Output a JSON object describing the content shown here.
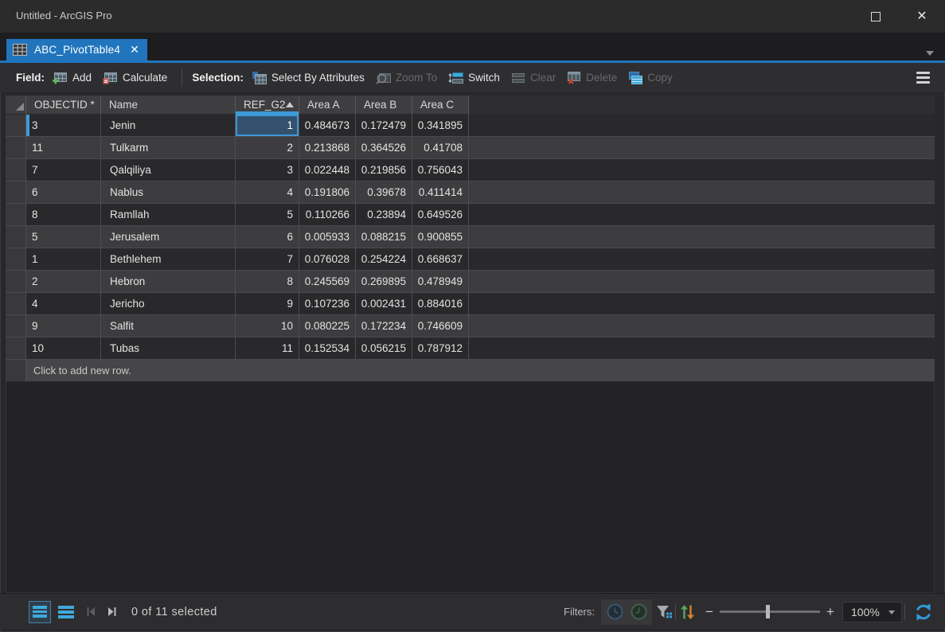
{
  "window": {
    "title": "Untitled - ArcGIS Pro"
  },
  "tab": {
    "label": "ABC_PivotTable4"
  },
  "toolbar": {
    "field_label": "Field:",
    "add": "Add",
    "calculate": "Calculate",
    "selection_label": "Selection:",
    "select_by_attributes": "Select By Attributes",
    "zoom_to": "Zoom To",
    "switch": "Switch",
    "clear": "Clear",
    "delete": "Delete",
    "copy": "Copy"
  },
  "table": {
    "columns": [
      {
        "key": "objectid",
        "label": "OBJECTID *"
      },
      {
        "key": "name",
        "label": "Name"
      },
      {
        "key": "ref_g2",
        "label": "REF_G2",
        "sorted": "ascending"
      },
      {
        "key": "area_a",
        "label": "Area A"
      },
      {
        "key": "area_b",
        "label": "Area B"
      },
      {
        "key": "area_c",
        "label": "Area C"
      }
    ],
    "rows": [
      {
        "objectid": "3",
        "name": "Jenin",
        "ref_g2": "1",
        "area_a": "0.484673",
        "area_b": "0.172479",
        "area_c": "0.341895"
      },
      {
        "objectid": "11",
        "name": "Tulkarm",
        "ref_g2": "2",
        "area_a": "0.213868",
        "area_b": "0.364526",
        "area_c": "0.41708"
      },
      {
        "objectid": "7",
        "name": "Qalqiliya",
        "ref_g2": "3",
        "area_a": "0.022448",
        "area_b": "0.219856",
        "area_c": "0.756043"
      },
      {
        "objectid": "6",
        "name": "Nablus",
        "ref_g2": "4",
        "area_a": "0.191806",
        "area_b": "0.39678",
        "area_c": "0.411414"
      },
      {
        "objectid": "8",
        "name": "Ramllah",
        "ref_g2": "5",
        "area_a": "0.110266",
        "area_b": "0.23894",
        "area_c": "0.649526"
      },
      {
        "objectid": "5",
        "name": "Jerusalem",
        "ref_g2": "6",
        "area_a": "0.005933",
        "area_b": "0.088215",
        "area_c": "0.900855"
      },
      {
        "objectid": "1",
        "name": "Bethlehem",
        "ref_g2": "7",
        "area_a": "0.076028",
        "area_b": "0.254224",
        "area_c": "0.668637"
      },
      {
        "objectid": "2",
        "name": "Hebron",
        "ref_g2": "8",
        "area_a": "0.245569",
        "area_b": "0.269895",
        "area_c": "0.478949"
      },
      {
        "objectid": "4",
        "name": "Jericho",
        "ref_g2": "9",
        "area_a": "0.107236",
        "area_b": "0.002431",
        "area_c": "0.884016"
      },
      {
        "objectid": "9",
        "name": "Salfit",
        "ref_g2": "10",
        "area_a": "0.080225",
        "area_b": "0.172234",
        "area_c": "0.746609"
      },
      {
        "objectid": "10",
        "name": "Tubas",
        "ref_g2": "11",
        "area_a": "0.152534",
        "area_b": "0.056215",
        "area_c": "0.787912"
      }
    ],
    "active_cell": {
      "row_index": 0,
      "column": "ref_g2"
    },
    "add_row_label": "Click to add new row."
  },
  "statusbar": {
    "selected_text": "0 of 11 selected",
    "filters_label": "Filters:",
    "zoom_value": "100%"
  },
  "colors": {
    "accent_blue": "#2175bd",
    "cell_highlight": "#3f9bd8",
    "icon_cyan": "#3fa9dc"
  }
}
